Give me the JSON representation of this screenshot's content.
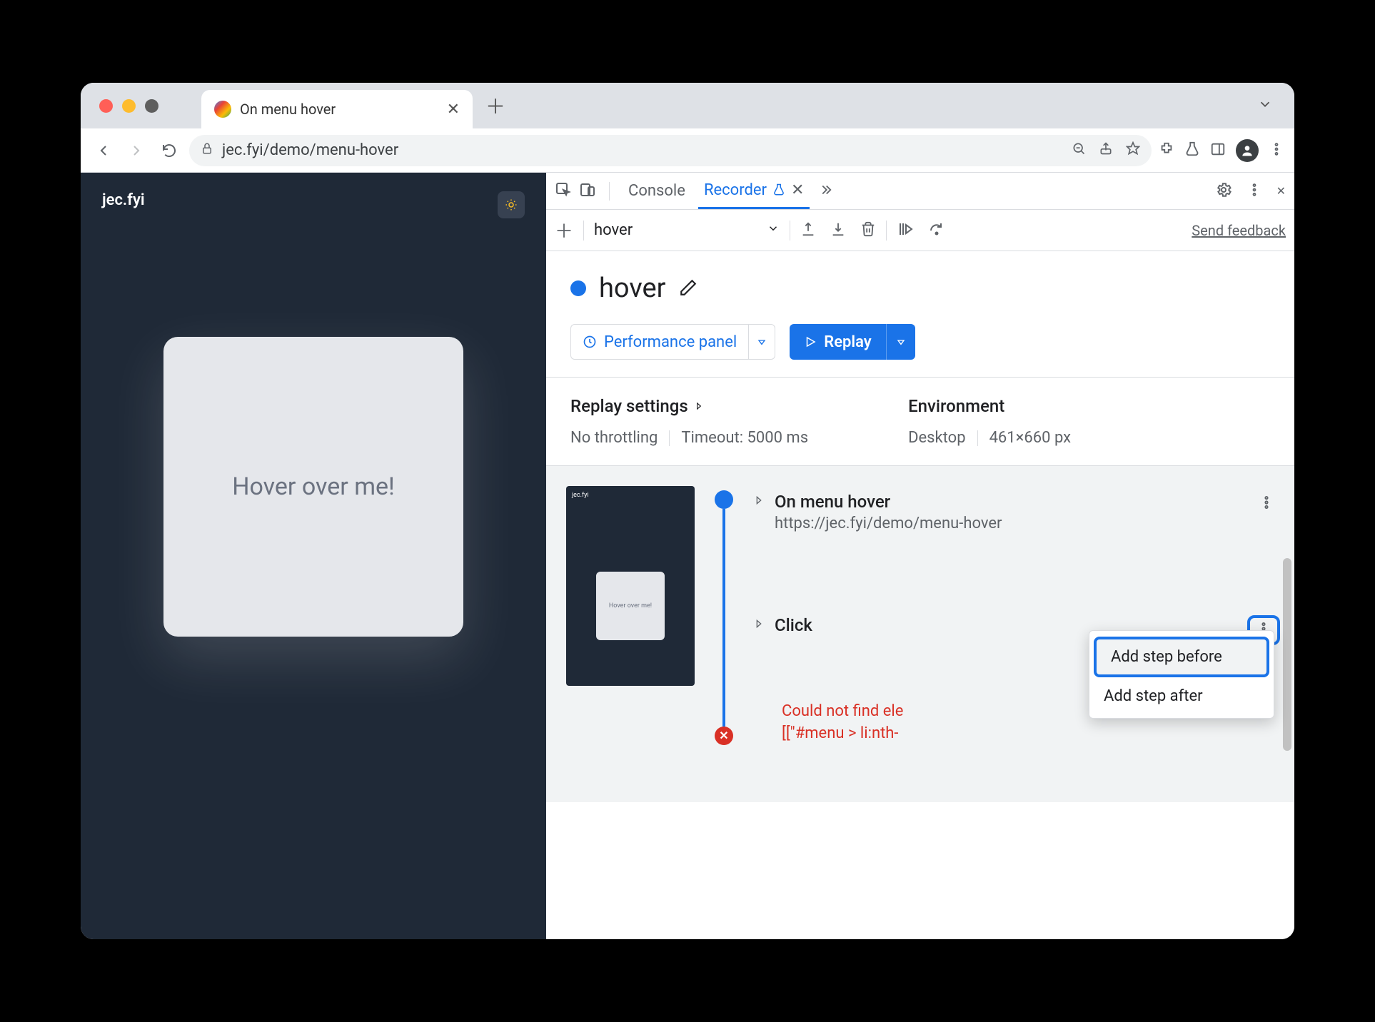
{
  "tab": {
    "title": "On menu hover"
  },
  "address": {
    "url": "jec.fyi/demo/menu-hover"
  },
  "page": {
    "site_title": "jec.fyi",
    "card_text": "Hover over me!"
  },
  "devtools": {
    "tabs": {
      "console": "Console",
      "recorder": "Recorder"
    },
    "toolbar": {
      "recording_select": "hover",
      "feedback": "Send feedback"
    },
    "recording": {
      "name": "hover",
      "perf_button": "Performance panel",
      "replay_button": "Replay"
    },
    "settings": {
      "replay_heading": "Replay settings",
      "throttling": "No throttling",
      "timeout": "Timeout: 5000 ms",
      "env_heading": "Environment",
      "env_device": "Desktop",
      "env_size": "461×660 px"
    },
    "steps": {
      "thumb_text": "Hover over me!",
      "first": {
        "title": "On menu hover",
        "url": "https://jec.fyi/demo/menu-hover"
      },
      "second": {
        "title": "Click"
      },
      "error_line1": "Could not find ele",
      "error_line2": "[[\"#menu > li:nth-"
    },
    "context_menu": {
      "before": "Add step before",
      "after": "Add step after"
    }
  }
}
